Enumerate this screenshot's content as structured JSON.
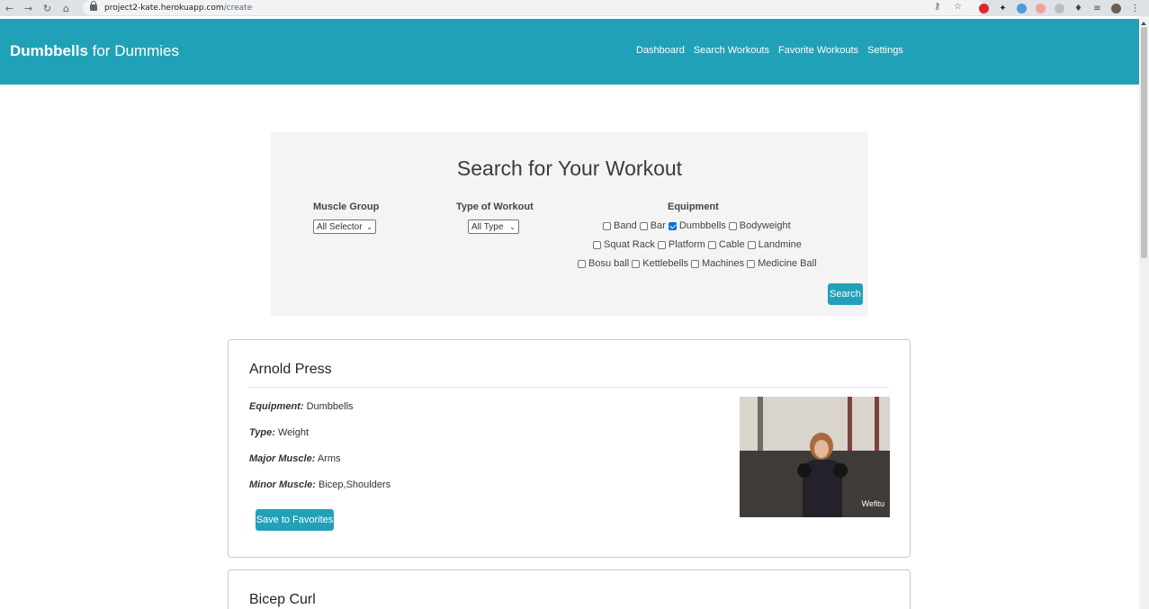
{
  "browser": {
    "url_domain": "project2-kate.herokuapp.com",
    "url_path": "/create"
  },
  "navbar": {
    "brand_bold": "Dumbbells",
    "brand_rest": " for Dummies",
    "links": [
      "Dashboard",
      "Search Workouts",
      "Favorite Workouts",
      "Settings"
    ]
  },
  "search": {
    "title": "Search for Your Workout",
    "muscle_group_label": "Muscle Group",
    "muscle_group_value": "All Selector",
    "type_label": "Type of Workout",
    "type_value": "All Type",
    "equipment_label": "Equipment",
    "equipment_rows": [
      [
        {
          "label": "Band",
          "checked": false
        },
        {
          "label": "Bar",
          "checked": false
        },
        {
          "label": "Dumbbells",
          "checked": true
        },
        {
          "label": "Bodyweight",
          "checked": false
        }
      ],
      [
        {
          "label": "Squat Rack",
          "checked": false
        },
        {
          "label": "Platform",
          "checked": false
        },
        {
          "label": "Cable",
          "checked": false
        },
        {
          "label": "Landmine",
          "checked": false
        }
      ],
      [
        {
          "label": "Bosu ball",
          "checked": false
        },
        {
          "label": "Kettlebells",
          "checked": false
        },
        {
          "label": "Machines",
          "checked": false
        },
        {
          "label": "Medicine Ball",
          "checked": false
        }
      ]
    ],
    "search_button": "Search"
  },
  "results": [
    {
      "name": "Arnold Press",
      "equipment_label": "Equipment:",
      "equipment": "Dumbbells",
      "type_label": "Type:",
      "type": "Weight",
      "major_label": "Major Muscle:",
      "major": "Arms",
      "minor_label": "Minor Muscle:",
      "minor": "Bicep,Shoulders",
      "save_button": "Save to Favorites",
      "image_watermark": "Wefitu"
    },
    {
      "name": "Bicep Curl"
    }
  ],
  "colors": {
    "accent": "#21a1b7",
    "panel_bg": "#f4f4f4",
    "card_border": "#c9c9c9"
  }
}
